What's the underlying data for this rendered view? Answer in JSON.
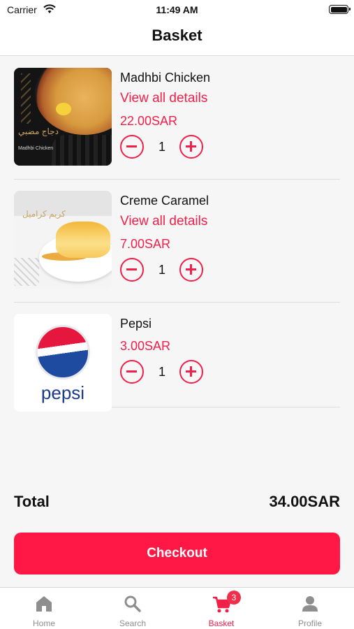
{
  "status_bar": {
    "carrier": "Carrier",
    "time": "11:49 AM"
  },
  "header": {
    "title": "Basket"
  },
  "basket": {
    "items": [
      {
        "name": "Madhbi Chicken",
        "details_link": "View all details",
        "price": "22.00SAR",
        "quantity": "1",
        "image_text_ar": "دجاج مضبي",
        "image_text_en": "Madhbi Chicken"
      },
      {
        "name": "Creme Caramel",
        "details_link": "View all details",
        "price": "7.00SAR",
        "quantity": "1",
        "image_text_ar": "كريم كراميل"
      },
      {
        "name": "Pepsi",
        "price": "3.00SAR",
        "quantity": "1",
        "image_text": "pepsi"
      }
    ]
  },
  "summary": {
    "total_label": "Total",
    "total_value": "34.00SAR"
  },
  "checkout": {
    "label": "Checkout"
  },
  "tab_bar": {
    "tabs": [
      {
        "label": "Home",
        "icon": "home-icon"
      },
      {
        "label": "Search",
        "icon": "search-icon"
      },
      {
        "label": "Basket",
        "icon": "cart-icon",
        "badge": "3",
        "active": true
      },
      {
        "label": "Profile",
        "icon": "person-icon"
      }
    ]
  },
  "colors": {
    "accent": "#f0204a",
    "checkout_background": "#ff1746",
    "page_background": "#f6f6f6",
    "tab_inactive": "#8e8e8e"
  }
}
